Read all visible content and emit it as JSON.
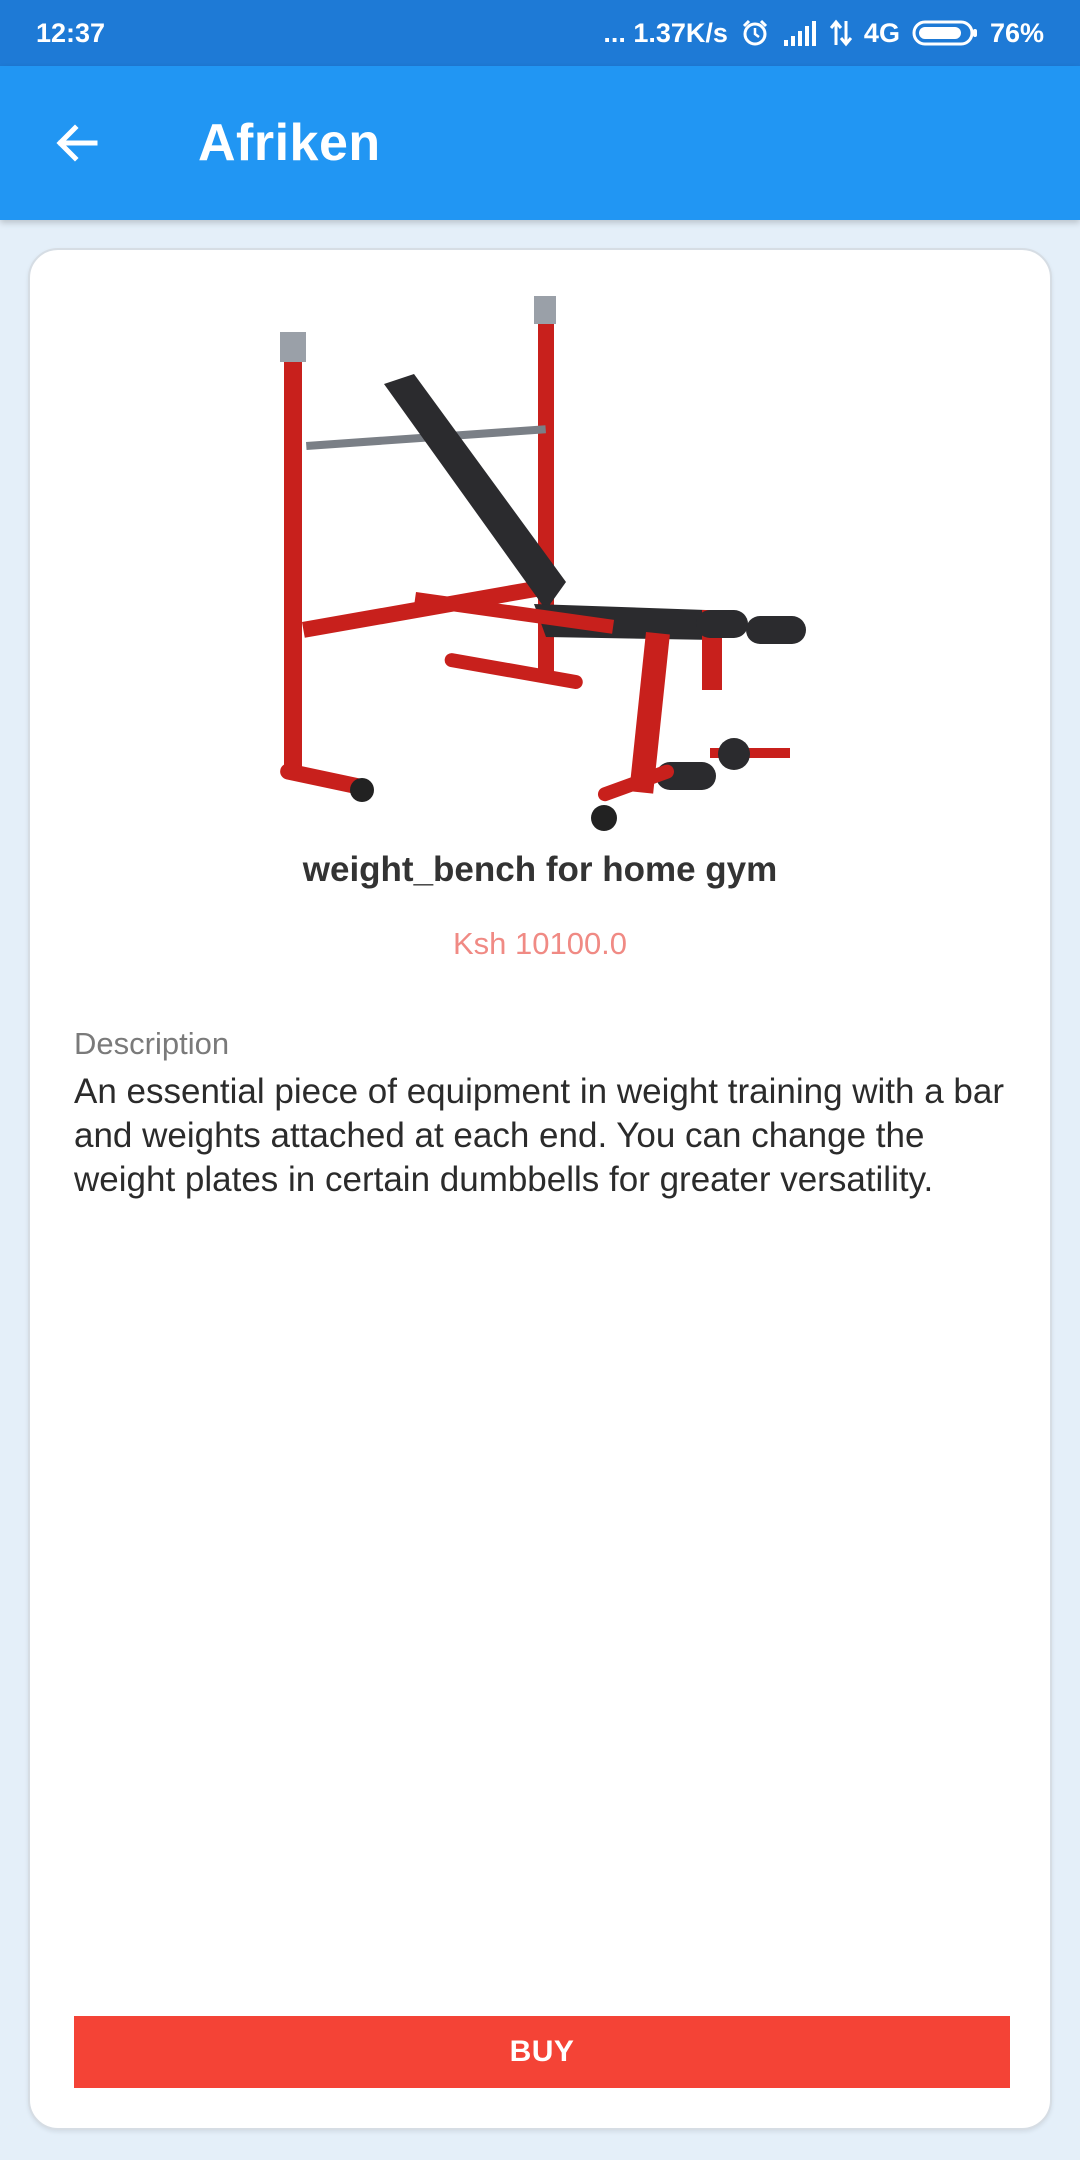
{
  "status_bar": {
    "time": "12:37",
    "network_speed": "... 1.37K/s",
    "network_type": "4G",
    "battery": "76%",
    "icons": [
      "alarm-icon",
      "signal-icon",
      "data-arrows-icon",
      "battery-icon"
    ]
  },
  "app_bar": {
    "title": "Afriken",
    "back_icon": "arrow-left-icon",
    "color": "#2196f3"
  },
  "product": {
    "name": "weight_bench for home gym",
    "price": "Ksh 10100.0",
    "description_label": "Description",
    "description": "An essential piece of equipment in weight training with a bar and weights attached at each end. You can change the weight plates in certain dumbbells for greater versatility.",
    "price_color": "#f08a84"
  },
  "actions": {
    "buy_label": "BUY",
    "buy_color": "#f44336"
  }
}
